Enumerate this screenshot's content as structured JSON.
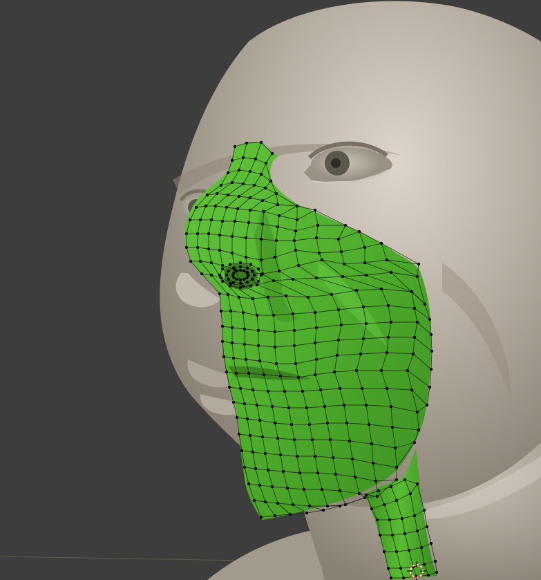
{
  "viewport": {
    "background_color": "#3d3d3d",
    "grid_line_color": "#5b5b4a"
  },
  "sculpt": {
    "skin_color": "#b5aca0",
    "skin_shadow_color": "#8a8175",
    "skin_highlight_color": "#d3cbc0",
    "eye_iris_color": "#4a473d"
  },
  "retopo_mesh": {
    "face_color": "#52b330",
    "face_dark_color": "#3f8f23",
    "face_highlight_color": "#6cd04a",
    "wire_color": "#1a2a12",
    "vertex_color": "#000000",
    "selection_state": "edit-mode"
  },
  "cursor_3d": {
    "icon": "crosshair-circle-icon",
    "ring_color_a": "#ff3333",
    "ring_color_b": "#ffffff"
  }
}
